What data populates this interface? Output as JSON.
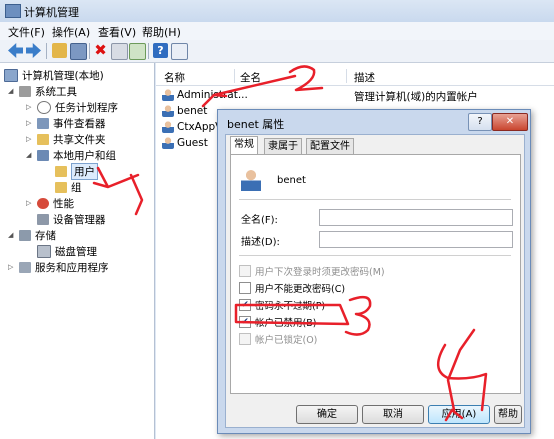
{
  "window": {
    "title": "计算机管理"
  },
  "menu": [
    "文件(F)",
    "操作(A)",
    "查看(V)",
    "帮助(H)"
  ],
  "tree": {
    "root": "计算机管理(本地)",
    "system_tools": "系统工具",
    "task_scheduler": "任务计划程序",
    "event_viewer": "事件查看器",
    "shared_folders": "共享文件夹",
    "local_users_groups": "本地用户和组",
    "users": "用户",
    "groups": "组",
    "performance": "性能",
    "device_manager": "设备管理器",
    "storage": "存储",
    "disk_management": "磁盘管理",
    "services_apps": "服务和应用程序"
  },
  "list": {
    "columns": [
      "名称",
      "全名",
      "描述"
    ],
    "rows": [
      {
        "name": "Administrat...",
        "full": "",
        "desc": "管理计算机(域)的内置帐户"
      },
      {
        "name": "benet",
        "full": "",
        "desc": ""
      },
      {
        "name": "CtxAppV",
        "full": "",
        "desc": ""
      },
      {
        "name": "Guest",
        "full": "",
        "desc": ""
      }
    ]
  },
  "dialog": {
    "title": "benet 属性",
    "help": "?",
    "close": "✕",
    "tabs": [
      "常规",
      "隶属于",
      "配置文件"
    ],
    "username": "benet",
    "fullname_label": "全名(F):",
    "fullname_value": "",
    "desc_label": "描述(D):",
    "desc_value": "",
    "checkboxes": [
      {
        "label": "用户下次登录时须更改密码(M)",
        "checked": false,
        "enabled": false
      },
      {
        "label": "用户不能更改密码(C)",
        "checked": false,
        "enabled": true
      },
      {
        "label": "密码永不过期(P)",
        "checked": true,
        "enabled": true
      },
      {
        "label": "帐户已禁用(B)",
        "checked": true,
        "enabled": true
      },
      {
        "label": "帐户已锁定(O)",
        "checked": false,
        "enabled": false
      }
    ],
    "buttons": {
      "ok": "确定",
      "cancel": "取消",
      "apply": "应用(A)",
      "help": "帮助"
    }
  },
  "annotations": [
    "1",
    "2",
    "3",
    "4"
  ],
  "colors": {
    "annotation_red": "#e8202a",
    "selection": "#dcebfc",
    "title_bg": "#c9d9ee"
  }
}
